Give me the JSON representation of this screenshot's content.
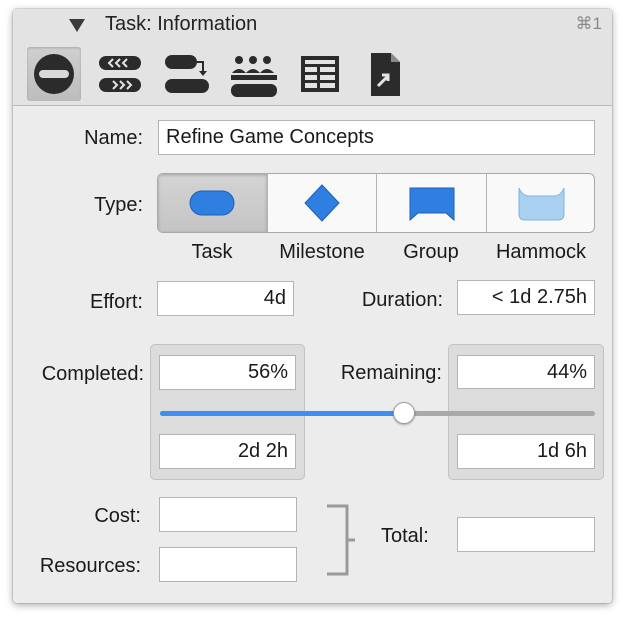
{
  "header": {
    "title": "Task: Information",
    "shortcut": "⌘1"
  },
  "toolbar": {
    "buttons": [
      {
        "name": "task-info-icon",
        "selected": true
      },
      {
        "name": "dependencies-icon",
        "selected": false
      },
      {
        "name": "structure-icon",
        "selected": false
      },
      {
        "name": "resources-icon",
        "selected": false
      },
      {
        "name": "custom-data-icon",
        "selected": false
      },
      {
        "name": "notes-icon",
        "selected": false
      }
    ]
  },
  "form": {
    "name_label": "Name:",
    "name_value": "Refine Game Concepts",
    "type_label": "Type:",
    "types": [
      {
        "label": "Task",
        "selected": true,
        "icon": "task-shape-icon"
      },
      {
        "label": "Milestone",
        "selected": false,
        "icon": "milestone-shape-icon"
      },
      {
        "label": "Group",
        "selected": false,
        "icon": "group-shape-icon"
      },
      {
        "label": "Hammock",
        "selected": false,
        "icon": "hammock-shape-icon"
      }
    ],
    "effort_label": "Effort:",
    "effort_value": "4d",
    "duration_label": "Duration:",
    "duration_value": "< 1d 2.75h",
    "completed_label": "Completed:",
    "completed_percent": "56%",
    "completed_effort": "2d 2h",
    "remaining_label": "Remaining:",
    "remaining_percent": "44%",
    "remaining_effort": "1d 6h",
    "progress_fraction": 0.56,
    "cost_label": "Cost:",
    "cost_value": "",
    "resources_label": "Resources:",
    "resources_value": "",
    "total_label": "Total:",
    "total_value": ""
  },
  "colors": {
    "accent": "#3f8ef3",
    "shape_blue": "#2f7fe0",
    "hammock_blue": "#a8d0f0"
  }
}
